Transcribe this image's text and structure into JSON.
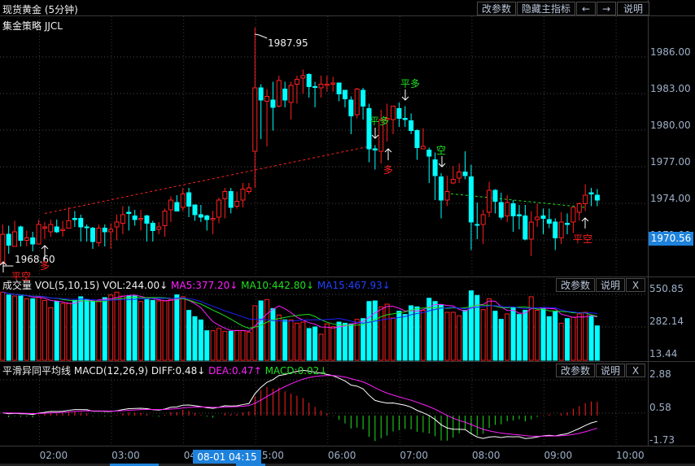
{
  "window": {
    "title": "现货黄金 (5分钟)",
    "strategy": "集金策略 JJCL"
  },
  "toolbar": {
    "change_params": "改参数",
    "hide_main": "隐藏主指标",
    "prev": "←",
    "next": "→",
    "help": "说明"
  },
  "volume_panel": {
    "name": "成交量",
    "params": "VOL(5,10,15)",
    "vol": "VOL:244.00↓",
    "ma5": "MA5:377.20↓",
    "ma10": "MA10:442.80↓",
    "ma15": "MA15:467.93↓",
    "change_params": "改参数",
    "help": "说明",
    "close": "X",
    "axis": [
      "550.85",
      "282.14",
      "13.44"
    ]
  },
  "macd_panel": {
    "name": "平滑异同平均线",
    "params": "MACD(12,26,9)",
    "diff": "DIFF:0.48↓",
    "dea": "DEA:0.47↑",
    "macd": "MACD:0.02↓",
    "change_params": "改参数",
    "help": "说明",
    "close": "X",
    "axis": [
      "2.88",
      "0.58",
      "-1.73"
    ]
  },
  "price_axis": [
    "1986.00",
    "1983.00",
    "1980.00",
    "1977.00",
    "1974.00",
    "1971.00"
  ],
  "current_price": "1970.56",
  "high_label": "1987.95",
  "low_label": "1968.60",
  "crosshair_time": "08-01 04:15",
  "time_axis": [
    "02:00",
    "03:00",
    "04:00",
    "05:00",
    "06:00",
    "07:00",
    "08:00",
    "09:00",
    "10:00"
  ],
  "signals": [
    {
      "text": "平空",
      "color": "#ff2020"
    },
    {
      "text": "多",
      "color": "#ff2020"
    },
    {
      "text": "平多",
      "color": "#20e020"
    },
    {
      "text": "平多",
      "color": "#20e020"
    },
    {
      "text": "多",
      "color": "#ff2020"
    },
    {
      "text": "空",
      "color": "#20e020"
    },
    {
      "text": "平空",
      "color": "#ff2020"
    }
  ],
  "colors": {
    "up": "#ff2020",
    "down": "#00ffff",
    "ma5": "#ff20ff",
    "ma10": "#20e020",
    "ma15": "#2020ff",
    "diff": "#ffffff",
    "dea": "#ff20ff",
    "accent": "#1e82dc"
  },
  "chart_data": {
    "type": "candlestick",
    "title": "现货黄金 (5分钟)",
    "ylim": [
      1968.5,
      1988.5
    ],
    "ohlc": [
      [
        1968.6,
        1971.8,
        1968.6,
        1971.0
      ],
      [
        1971.0,
        1971.7,
        1969.4,
        1970.1
      ],
      [
        1970.0,
        1972.1,
        1970.0,
        1971.2
      ],
      [
        1971.6,
        1971.7,
        1970.0,
        1970.5
      ],
      [
        1970.5,
        1971.3,
        1970.0,
        1970.7
      ],
      [
        1970.7,
        1971.2,
        1969.6,
        1970.2
      ],
      [
        1970.2,
        1972.2,
        1970.2,
        1971.8
      ],
      [
        1971.5,
        1972.0,
        1970.6,
        1971.6
      ],
      [
        1971.2,
        1972.2,
        1970.8,
        1971.8
      ],
      [
        1971.6,
        1972.2,
        1971.1,
        1971.2
      ],
      [
        1971.3,
        1972.1,
        1970.8,
        1971.4
      ],
      [
        1971.5,
        1973.2,
        1971.5,
        1972.1
      ],
      [
        1972.3,
        1972.9,
        1971.6,
        1972.2
      ],
      [
        1972.3,
        1972.6,
        1970.4,
        1971.6
      ],
      [
        1971.6,
        1971.8,
        1970.4,
        1971.6
      ],
      [
        1971.5,
        1971.6,
        1969.8,
        1970.4
      ],
      [
        1970.3,
        1971.8,
        1970.0,
        1971.5
      ],
      [
        1971.5,
        1971.8,
        1970.0,
        1971.2
      ],
      [
        1971.2,
        1971.9,
        1969.8,
        1971.4
      ],
      [
        1971.6,
        1972.6,
        1970.5,
        1972.0
      ],
      [
        1971.9,
        1973.3,
        1971.0,
        1972.6
      ],
      [
        1972.8,
        1973.3,
        1971.3,
        1972.7
      ],
      [
        1972.5,
        1973.0,
        1971.7,
        1972.2
      ],
      [
        1972.2,
        1973.0,
        1971.3,
        1972.3
      ],
      [
        1972.5,
        1972.6,
        1970.4,
        1971.9
      ],
      [
        1971.9,
        1972.1,
        1970.4,
        1971.3
      ],
      [
        1971.4,
        1972.0,
        1971.0,
        1971.6
      ],
      [
        1971.7,
        1973.1,
        1970.8,
        1972.9
      ],
      [
        1973.0,
        1974.1,
        1972.0,
        1973.8
      ],
      [
        1973.6,
        1974.2,
        1972.9,
        1972.9
      ],
      [
        1973.2,
        1974.8,
        1972.9,
        1974.3
      ],
      [
        1974.4,
        1974.8,
        1972.4,
        1973.3
      ],
      [
        1973.4,
        1973.4,
        1972.1,
        1972.6
      ],
      [
        1972.6,
        1973.4,
        1972.0,
        1972.4
      ],
      [
        1972.5,
        1972.6,
        1971.3,
        1972.2
      ],
      [
        1972.2,
        1972.9,
        1971.0,
        1972.3
      ],
      [
        1972.4,
        1974.0,
        1971.9,
        1973.8
      ],
      [
        1973.9,
        1974.8,
        1972.3,
        1974.5
      ],
      [
        1974.5,
        1974.8,
        1972.7,
        1973.2
      ],
      [
        1973.3,
        1974.5,
        1973.1,
        1973.7
      ],
      [
        1973.8,
        1975.2,
        1973.2,
        1974.7
      ],
      [
        1974.5,
        1975.2,
        1974.3,
        1974.8
      ],
      [
        1977.8,
        1987.95,
        1974.8,
        1983.0
      ],
      [
        1983.0,
        1983.3,
        1978.8,
        1982.0
      ],
      [
        1981.9,
        1982.9,
        1978.2,
        1982.3
      ],
      [
        1982.0,
        1983.5,
        1979.5,
        1981.4
      ],
      [
        1981.5,
        1984.0,
        1981.4,
        1983.6
      ],
      [
        1982.9,
        1983.5,
        1981.4,
        1982.0
      ],
      [
        1981.8,
        1983.5,
        1980.4,
        1983.2
      ],
      [
        1983.3,
        1984.0,
        1981.7,
        1983.7
      ],
      [
        1983.8,
        1984.5,
        1982.5,
        1984.0
      ],
      [
        1984.1,
        1984.2,
        1982.2,
        1983.1
      ],
      [
        1983.1,
        1983.5,
        1981.4,
        1983.1
      ],
      [
        1983.0,
        1984.0,
        1982.2,
        1983.3
      ],
      [
        1983.2,
        1984.0,
        1982.7,
        1983.3
      ],
      [
        1983.3,
        1983.9,
        1982.7,
        1983.4
      ],
      [
        1983.4,
        1983.4,
        1981.9,
        1982.5
      ],
      [
        1982.8,
        1982.8,
        1981.4,
        1982.1
      ],
      [
        1982.0,
        1982.3,
        1979.2,
        1980.7
      ],
      [
        1980.8,
        1983.0,
        1980.5,
        1982.9
      ],
      [
        1982.8,
        1983.0,
        1980.4,
        1981.5
      ],
      [
        1981.3,
        1981.7,
        1976.9,
        1978.0
      ],
      [
        1978.0,
        1978.3,
        1976.3,
        1977.9
      ],
      [
        1977.8,
        1981.2,
        1976.8,
        1980.4
      ],
      [
        1980.4,
        1981.7,
        1978.6,
        1980.5
      ],
      [
        1980.4,
        1981.5,
        1979.2,
        1981.5
      ],
      [
        1981.3,
        1981.8,
        1979.8,
        1980.5
      ],
      [
        1980.5,
        1981.5,
        1979.8,
        1980.4
      ],
      [
        1980.3,
        1980.9,
        1979.2,
        1979.5
      ],
      [
        1979.5,
        1979.6,
        1977.1,
        1978.1
      ],
      [
        1978.0,
        1979.7,
        1978.0,
        1978.2
      ],
      [
        1977.9,
        1978.1,
        1975.2,
        1977.4
      ],
      [
        1977.1,
        1977.7,
        1973.8,
        1975.8
      ],
      [
        1975.7,
        1976.0,
        1972.3,
        1973.8
      ],
      [
        1973.8,
        1975.8,
        1973.3,
        1974.5
      ],
      [
        1975.2,
        1976.6,
        1975.1,
        1975.5
      ],
      [
        1975.6,
        1976.8,
        1975.2,
        1976.1
      ],
      [
        1976.1,
        1977.8,
        1975.5,
        1975.8
      ],
      [
        1975.7,
        1976.7,
        1969.7,
        1972.0
      ],
      [
        1971.8,
        1973.6,
        1970.6,
        1971.8
      ],
      [
        1971.8,
        1973.0,
        1970.2,
        1972.6
      ],
      [
        1972.8,
        1975.3,
        1972.4,
        1974.6
      ],
      [
        1974.6,
        1974.7,
        1972.7,
        1973.7
      ],
      [
        1973.6,
        1974.4,
        1972.2,
        1972.4
      ],
      [
        1972.5,
        1974.2,
        1972.0,
        1973.6
      ],
      [
        1973.5,
        1973.8,
        1971.2,
        1972.5
      ],
      [
        1972.6,
        1973.4,
        1971.4,
        1972.5
      ],
      [
        1972.5,
        1973.4,
        1970.5,
        1970.6
      ],
      [
        1970.6,
        1972.9,
        1969.2,
        1972.0
      ],
      [
        1972.2,
        1973.5,
        1971.6,
        1972.4
      ],
      [
        1972.5,
        1973.1,
        1971.0,
        1972.3
      ],
      [
        1972.2,
        1973.1,
        1971.5,
        1971.9
      ],
      [
        1972.0,
        1972.3,
        1969.7,
        1970.7
      ],
      [
        1970.7,
        1972.8,
        1970.2,
        1972.0
      ],
      [
        1971.9,
        1972.7,
        1971.0,
        1971.8
      ],
      [
        1972.0,
        1973.2,
        1971.1,
        1973.2
      ],
      [
        1972.8,
        1973.6,
        1972.1,
        1973.5
      ],
      [
        1973.5,
        1975.1,
        1972.9,
        1974.2
      ],
      [
        1974.4,
        1974.8,
        1973.3,
        1974.3
      ],
      [
        1974.2,
        1974.7,
        1973.3,
        1973.8
      ]
    ],
    "up_candles": [
      0,
      2,
      4,
      6,
      7,
      8,
      10,
      11,
      16,
      18,
      19,
      20,
      23,
      26,
      27,
      28,
      30,
      35,
      36,
      37,
      39,
      40,
      41,
      42,
      44,
      46,
      48,
      49,
      50,
      53,
      54,
      55,
      59,
      63,
      64,
      65,
      70,
      74,
      75,
      76,
      80,
      81,
      84,
      88,
      89,
      93,
      95,
      96,
      97
    ],
    "volume": [
      522,
      499,
      490,
      490,
      468,
      468,
      484,
      454,
      394,
      445,
      428,
      428,
      454,
      484,
      461,
      445,
      450,
      477,
      499,
      522,
      490,
      490,
      490,
      445,
      461,
      454,
      450,
      450,
      461,
      500,
      484,
      372,
      320,
      293,
      204,
      204,
      222,
      199,
      199,
      204,
      204,
      192,
      410,
      450,
      461,
      387,
      334,
      293,
      293,
      266,
      275,
      222,
      235,
      175,
      260,
      237,
      275,
      266,
      260,
      298,
      304,
      445,
      450,
      401,
      423,
      309,
      365,
      338,
      410,
      401,
      372,
      472,
      445,
      416,
      356,
      356,
      327,
      372,
      533,
      495,
      378,
      468,
      365,
      298,
      343,
      394,
      338,
      372,
      484,
      372,
      387,
      320,
      360,
      266,
      304,
      316,
      343,
      356,
      327,
      244
    ],
    "volume_ylim": [
      0,
      600
    ],
    "macd_ylim": [
      -1.73,
      2.88
    ],
    "trend_lines": [
      {
        "color": "#ff2020",
        "from": [
          7,
          1972.7
        ],
        "to": [
          62,
          1978.3
        ]
      },
      {
        "color": "#20e020",
        "from": [
          73,
          1974.4
        ],
        "to": [
          97,
          1973.2
        ]
      }
    ]
  }
}
